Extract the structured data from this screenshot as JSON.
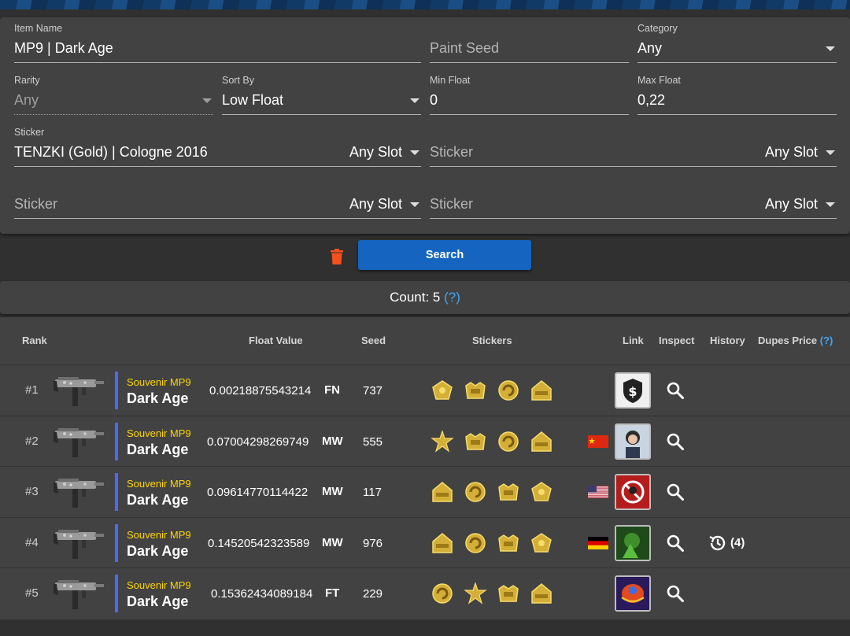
{
  "filters": {
    "item_name": {
      "label": "Item Name",
      "value": "MP9 | Dark Age"
    },
    "paint_seed": {
      "placeholder": "Paint Seed"
    },
    "category": {
      "label": "Category",
      "value": "Any"
    },
    "rarity": {
      "label": "Rarity",
      "value": "Any"
    },
    "sort_by": {
      "label": "Sort By",
      "value": "Low Float"
    },
    "min_float": {
      "label": "Min Float",
      "value": "0"
    },
    "max_float": {
      "label": "Max Float",
      "value": "0,22"
    },
    "sticker1": {
      "label": "Sticker",
      "value": "TENZKI (Gold) | Cologne 2016",
      "slot": "Any Slot"
    },
    "sticker2": {
      "placeholder": "Sticker",
      "slot": "Any Slot"
    },
    "sticker3": {
      "placeholder": "Sticker",
      "slot": "Any Slot"
    },
    "sticker4": {
      "placeholder": "Sticker",
      "slot": "Any Slot"
    }
  },
  "actions": {
    "search_label": "Search"
  },
  "count": {
    "label": "Count: 5",
    "help": "(?)"
  },
  "table": {
    "headers": {
      "rank": "Rank",
      "float": "Float Value",
      "seed": "Seed",
      "stickers": "Stickers",
      "link": "Link",
      "inspect": "Inspect",
      "history": "History",
      "dupes": "Dupes Price",
      "dupes_help": "(?)"
    },
    "rows": [
      {
        "rank": "#1",
        "quality": "Souvenir MP9",
        "skin": "Dark Age",
        "float": "0.00218875543214",
        "wear": "FN",
        "seed": "737",
        "flag": "",
        "avatar": "dollar-shield",
        "history": ""
      },
      {
        "rank": "#2",
        "quality": "Souvenir MP9",
        "skin": "Dark Age",
        "float": "0.07004298269749",
        "wear": "MW",
        "seed": "555",
        "flag": "china-flag-icon",
        "avatar": "person",
        "history": ""
      },
      {
        "rank": "#3",
        "quality": "Souvenir MP9",
        "skin": "Dark Age",
        "float": "0.09614770114422",
        "wear": "MW",
        "seed": "117",
        "flag": "usa-flag-icon",
        "avatar": "red-prohibited",
        "history": ""
      },
      {
        "rank": "#4",
        "quality": "Souvenir MP9",
        "skin": "Dark Age",
        "float": "0.14520542323589",
        "wear": "MW",
        "seed": "976",
        "flag": "germany-flag-icon",
        "avatar": "green-art",
        "history": "(4)"
      },
      {
        "rank": "#5",
        "quality": "Souvenir MP9",
        "skin": "Dark Age",
        "float": "0.15362434089184",
        "wear": "FT",
        "seed": "229",
        "flag": "",
        "avatar": "scarab",
        "history": ""
      }
    ]
  },
  "colors": {
    "accent": "#1565c0",
    "souvenir": "#ffd700",
    "quality_bar": "#4b69ff",
    "trash": "#f4511e",
    "help": "#42a5f5"
  }
}
